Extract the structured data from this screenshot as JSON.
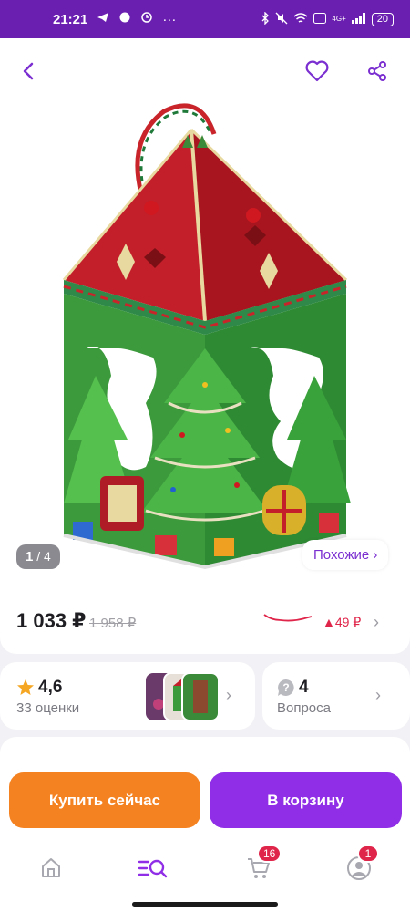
{
  "status_bar": {
    "time": "21:21",
    "network": "4G+",
    "battery": "20"
  },
  "gallery": {
    "counter_current": "1",
    "counter_total": "/ 4",
    "similar_label": "Похожие ›"
  },
  "price": {
    "current": "1 033 ₽",
    "old": "1 958 ₽",
    "delta": "▲49 ₽"
  },
  "rating": {
    "value": "4,6",
    "count_label": "33 оценки"
  },
  "questions": {
    "count": "4",
    "label": "Вопроса"
  },
  "actions": {
    "buy_now": "Купить сейчас",
    "to_cart": "В корзину"
  },
  "bottom_nav": {
    "cart_badge": "16",
    "profile_badge": "1"
  },
  "colors": {
    "brand": "#6b1fb1",
    "buy_now": "#f58220",
    "to_cart": "#8f2ee6",
    "price_up": "#e0254a"
  }
}
